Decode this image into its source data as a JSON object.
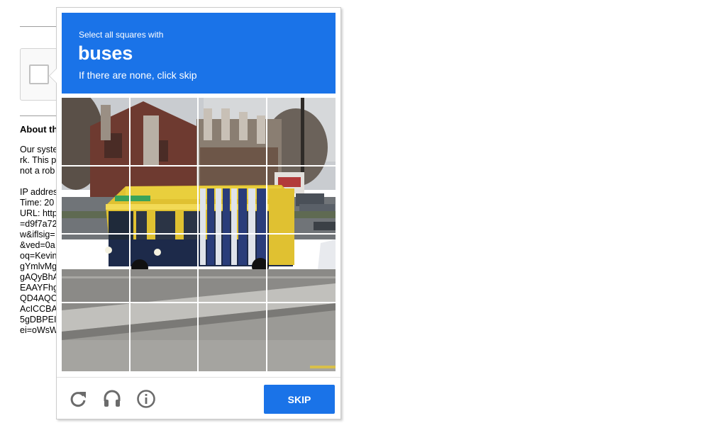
{
  "background": {
    "heading": "About th",
    "paragraph_lines": [
      "Our syste",
      "rk. This p",
      "not a rob"
    ],
    "detail_lines": [
      "IP addres",
      "Time: 20",
      "URL: http",
      "=d9f7a72",
      "w&iflsig=",
      "&ved=0a",
      "oq=Kevin",
      "gYmlvMg",
      "gAQyBhA",
      "EAAYFhg",
      "QD4AQC",
      "AcICCBA",
      "5gDBPEI",
      "ei=oWsW"
    ]
  },
  "captcha": {
    "instruction_top": "Select all squares with",
    "target_object": "buses",
    "instruction_bottom": "If there are none, click skip",
    "skip_label": "SKIP",
    "accent_color": "#1a73e8",
    "footer_icons": [
      "reload-icon",
      "audio-icon",
      "info-icon"
    ]
  }
}
